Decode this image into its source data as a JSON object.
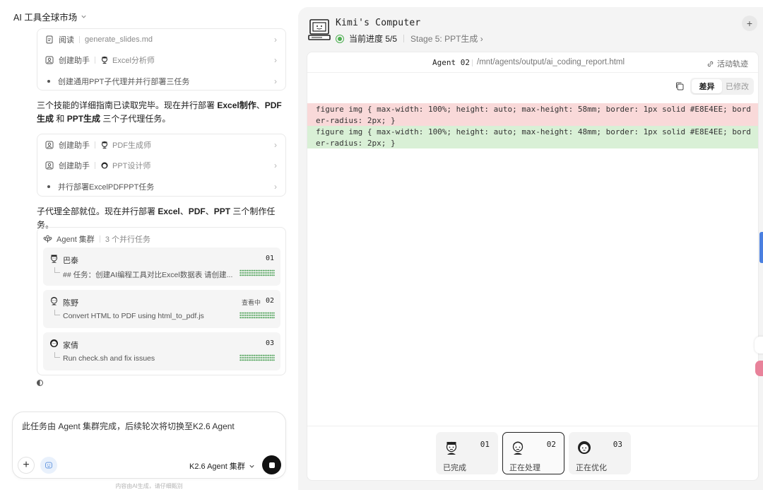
{
  "header": {
    "title": "AI 工具全球市场"
  },
  "steps_top": [
    {
      "kind": "read",
      "label": "阅读",
      "detail": "generate_slides.md"
    },
    {
      "kind": "assistant",
      "label": "创建助手",
      "detail": "Excel分析师"
    },
    {
      "kind": "dot",
      "label": "创建通用PPT子代理并并行部署三任务",
      "detail": ""
    }
  ],
  "para1": {
    "a": "三个技能的详细指南已读取完毕。现在并行部署 ",
    "b1": "Excel制作",
    "c": "、",
    "b2": "PDF生成",
    "d": " 和 ",
    "b3": "PPT生成",
    "e": " 三个子代理任务。"
  },
  "steps_mid": [
    {
      "kind": "assistant",
      "label": "创建助手",
      "detail": "PDF生成师"
    },
    {
      "kind": "assistant",
      "label": "创建助手",
      "detail": "PPT设计师"
    },
    {
      "kind": "dot",
      "label": "并行部署ExcelPDFPPT任务",
      "detail": ""
    }
  ],
  "para2": {
    "a": "子代理全部就位。现在并行部署 ",
    "b1": "Excel",
    "c": "、",
    "b2": "PDF",
    "d": "、",
    "b3": "PPT",
    "e": " 三个制作任务。"
  },
  "cluster": {
    "title": "Agent 集群",
    "count": "3 个并行任务",
    "tasks": [
      {
        "name": "巴泰",
        "num": "01",
        "status": "",
        "desc": "## 任务：创建AI编程工具对比Excel数据表 请创建..."
      },
      {
        "name": "陈野",
        "num": "02",
        "status": "查看中",
        "desc": "Convert HTML to PDF using html_to_pdf.js"
      },
      {
        "name": "家倩",
        "num": "03",
        "status": "",
        "desc": "Run check.sh and fix issues"
      }
    ]
  },
  "input": {
    "text": "此任务由 Agent 集群完成，后续轮次将切换至K2.6 Agent",
    "model": "K2.6 Agent 集群"
  },
  "footnote": "内容由AI生成，请仔细甄别",
  "computer": {
    "title": "Kimi's Computer",
    "progress": "当前进度 5/5",
    "stage": "Stage 5: PPT生成",
    "agent": "Agent 02",
    "path": "/mnt/agents/output/ai_coding_report.html",
    "trail": "活动轨迹",
    "toggle": {
      "diff": "差异",
      "modified": "已修改"
    },
    "diff_removed": "figure img { max-width: 100%; height: auto; max-height: 58mm; border: 1px solid #E8E4EE; border-radius: 2px; }",
    "diff_added": "figure img { max-width: 100%; height: auto; max-height: 48mm; border: 1px solid #E8E4EE; border-radius: 2px; }",
    "agents": [
      {
        "num": "01",
        "label": "已完成"
      },
      {
        "num": "02",
        "label": "正在处理"
      },
      {
        "num": "03",
        "label": "正在优化"
      }
    ]
  },
  "colors": {
    "removed_bg": "#f9d9d9",
    "added_bg": "#d9f0d6",
    "status_green": "#4caf50",
    "accent_blue": "#4a7fe0"
  }
}
